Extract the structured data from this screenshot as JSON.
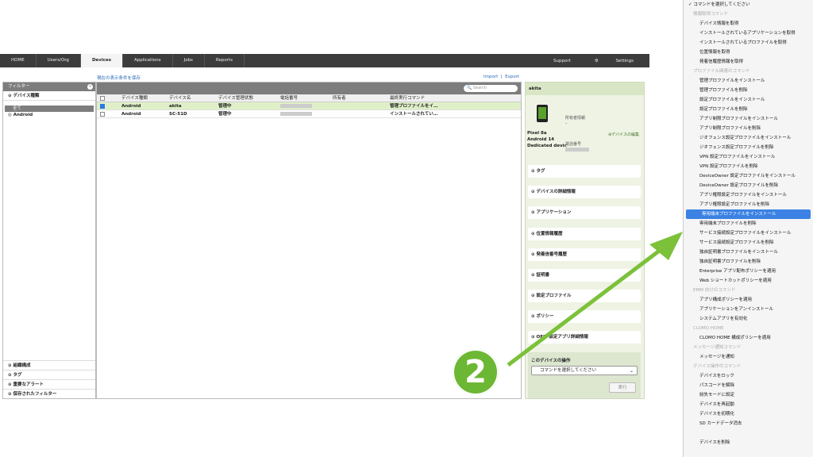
{
  "nav": {
    "tabs": [
      "HOME",
      "Users/Org",
      "Devices",
      "Applications",
      "Jobs",
      "Reports"
    ],
    "support": "Support",
    "settings": "Settings"
  },
  "savebar": "現在の表示条件を保存",
  "import": "Import",
  "export": "Export",
  "sidebar": {
    "title": "フィルター",
    "section": "デバイス種類",
    "selected": "全て",
    "item": "Android",
    "bottom": [
      "組織構成",
      "タグ",
      "重要なアラート",
      "保存されたフィルター"
    ]
  },
  "search": {
    "placeholder": "Search"
  },
  "table": {
    "headers": [
      "デバイス種類",
      "デバイス名",
      "デバイス管理状態",
      "電話番号",
      "所有者",
      "最終実行コマンド"
    ],
    "rows": [
      {
        "type": "Android",
        "name": "akita",
        "state": "管理中",
        "cmd": "管理プロファイルをイ…",
        "checked": true
      },
      {
        "type": "Android",
        "name": "SC-51D",
        "state": "管理中",
        "cmd": "インストールされてい…",
        "checked": false
      }
    ]
  },
  "detail": {
    "title": "akita",
    "model": "Pixel 8a",
    "os": "Android 14",
    "mode": "Dedicated devic",
    "owner_label": "所有者情報",
    "owner_value": "–",
    "edit": "デバイスの編集",
    "phone_label": "電話番号",
    "sections": [
      "タグ",
      "デバイスの詳細情報",
      "アプリケーション",
      "位置情報履歴",
      "発着信番号履歴",
      "証明書",
      "設定プロファイル",
      "ポリシー",
      "OEM 設定アプリ詳細情報"
    ],
    "op_title": "このデバイスの操作",
    "op_select": "コマンドを選択してください",
    "op_run": "実行"
  },
  "badge": "2",
  "menu": [
    {
      "t": "コマンドを選択してください",
      "k": "chk"
    },
    {
      "t": "情報取得コマンド",
      "k": "hdr"
    },
    {
      "t": "デバイス情報を取得",
      "k": "it"
    },
    {
      "t": "インストールされているアプリケーションを取得",
      "k": "it"
    },
    {
      "t": "インストールされているプロファイルを取得",
      "k": "it"
    },
    {
      "t": "位置情報を取得",
      "k": "it"
    },
    {
      "t": "発着信履歴情報を取得",
      "k": "it"
    },
    {
      "t": "プロファイル関連のコマンド",
      "k": "hdr"
    },
    {
      "t": "管理プロファイルをインストール",
      "k": "it"
    },
    {
      "t": "管理プロファイルを削除",
      "k": "it"
    },
    {
      "t": "設定プロファイルをインストール",
      "k": "it"
    },
    {
      "t": "設定プロファイルを削除",
      "k": "it"
    },
    {
      "t": "アプリ制限プロファイルをインストール",
      "k": "it"
    },
    {
      "t": "アプリ制限プロファイルを削除",
      "k": "it"
    },
    {
      "t": "ジオフェンス設定プロファイルをインストール",
      "k": "it"
    },
    {
      "t": "ジオフェンス設定プロファイルを削除",
      "k": "it"
    },
    {
      "t": "VPN 設定プロファイルをインストール",
      "k": "it"
    },
    {
      "t": "VPN 設定プロファイルを削除",
      "k": "it"
    },
    {
      "t": "DeviceOwner 設定プロファイルをインストール",
      "k": "it"
    },
    {
      "t": "DeviceOwner 設定プロファイルを削除",
      "k": "it"
    },
    {
      "t": "アプリ権限設定プロファイルをインストール",
      "k": "it"
    },
    {
      "t": "アプリ権限設定プロファイルを削除",
      "k": "it"
    },
    {
      "t": "専用端末プロファイルをインストール",
      "k": "hl"
    },
    {
      "t": "専用端末プロファイルを削除",
      "k": "it"
    },
    {
      "t": "サービス接続設定プロファイルをインストール",
      "k": "it"
    },
    {
      "t": "サービス接続設定プロファイルを削除",
      "k": "it"
    },
    {
      "t": "独自証明書プロファイルをインストール",
      "k": "it"
    },
    {
      "t": "独自証明書プロファイルを削除",
      "k": "it"
    },
    {
      "t": "Enterprise アプリ配布ポリシーを適用",
      "k": "it"
    },
    {
      "t": "Web ショートカットポリシーを適用",
      "k": "it"
    },
    {
      "t": "EMM 向けのコマンド",
      "k": "hdr"
    },
    {
      "t": "アプリ構成ポリシーを適用",
      "k": "it"
    },
    {
      "t": "アプリケーションをアンインストール",
      "k": "it"
    },
    {
      "t": "システムアプリを有効化",
      "k": "it"
    },
    {
      "t": "CLOMO HOME",
      "k": "hdr"
    },
    {
      "t": "CLOMO HOME 構成ポリシーを適用",
      "k": "it"
    },
    {
      "t": "メッセージ通知コマンド",
      "k": "hdr"
    },
    {
      "t": "メッセージを通知",
      "k": "it"
    },
    {
      "t": "デバイス操作のコマンド",
      "k": "hdr"
    },
    {
      "t": "デバイスをロック",
      "k": "it"
    },
    {
      "t": "パスコードを解除",
      "k": "it"
    },
    {
      "t": "紛失モードに設定",
      "k": "it"
    },
    {
      "t": "デバイスを再起動",
      "k": "it"
    },
    {
      "t": "デバイスを初期化",
      "k": "it"
    },
    {
      "t": "SD カードデータ消去",
      "k": "it"
    },
    {
      "t": "",
      "k": "gap"
    },
    {
      "t": "デバイスを削除",
      "k": "it"
    }
  ]
}
